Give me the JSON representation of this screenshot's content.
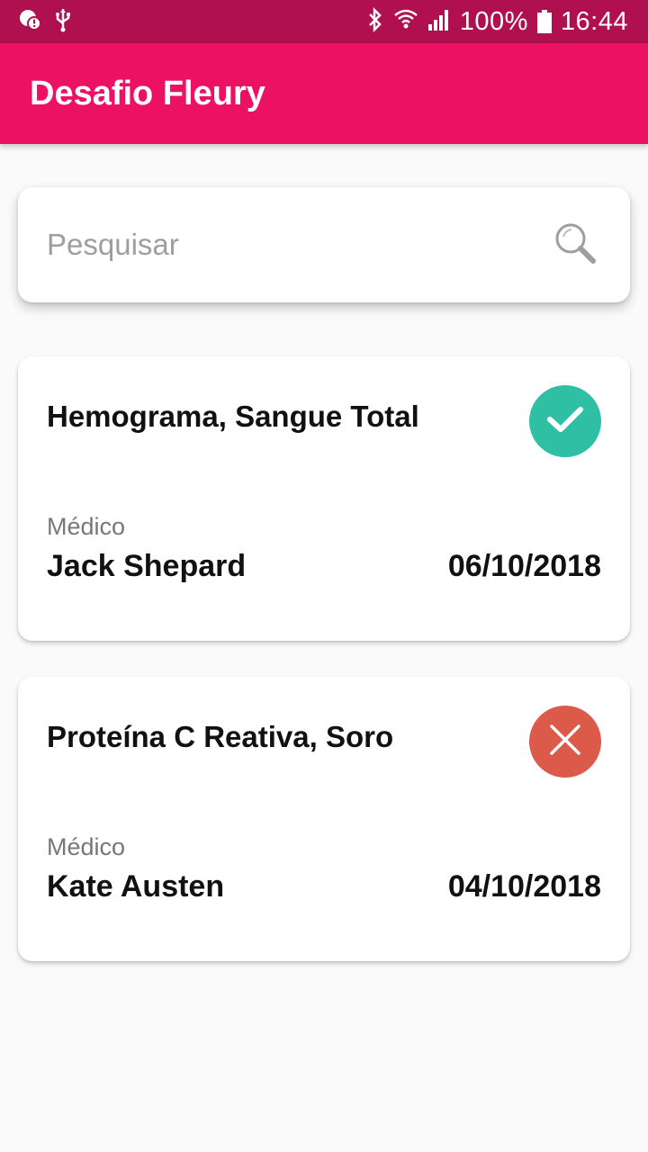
{
  "status_bar": {
    "battery_text": "100%",
    "time": "16:44"
  },
  "app_bar": {
    "title": "Desafio Fleury"
  },
  "search": {
    "placeholder": "Pesquisar",
    "value": "",
    "icon": "search-icon"
  },
  "exams": [
    {
      "title": "Hemograma, Sangue Total",
      "doctor_label": "Médico",
      "doctor": "Jack Shepard",
      "date": "06/10/2018",
      "status": "check-icon",
      "status_color": "#2ebfa5"
    },
    {
      "title": "Proteína C Reativa, Soro",
      "doctor_label": "Médico",
      "doctor": "Kate Austen",
      "date": "04/10/2018",
      "status": "close-icon",
      "status_color": "#dc5a4a"
    }
  ],
  "colors": {
    "primary": "#ed1164",
    "primary_dark": "#b0104f",
    "success": "#2ebfa5",
    "error": "#dc5a4a"
  }
}
